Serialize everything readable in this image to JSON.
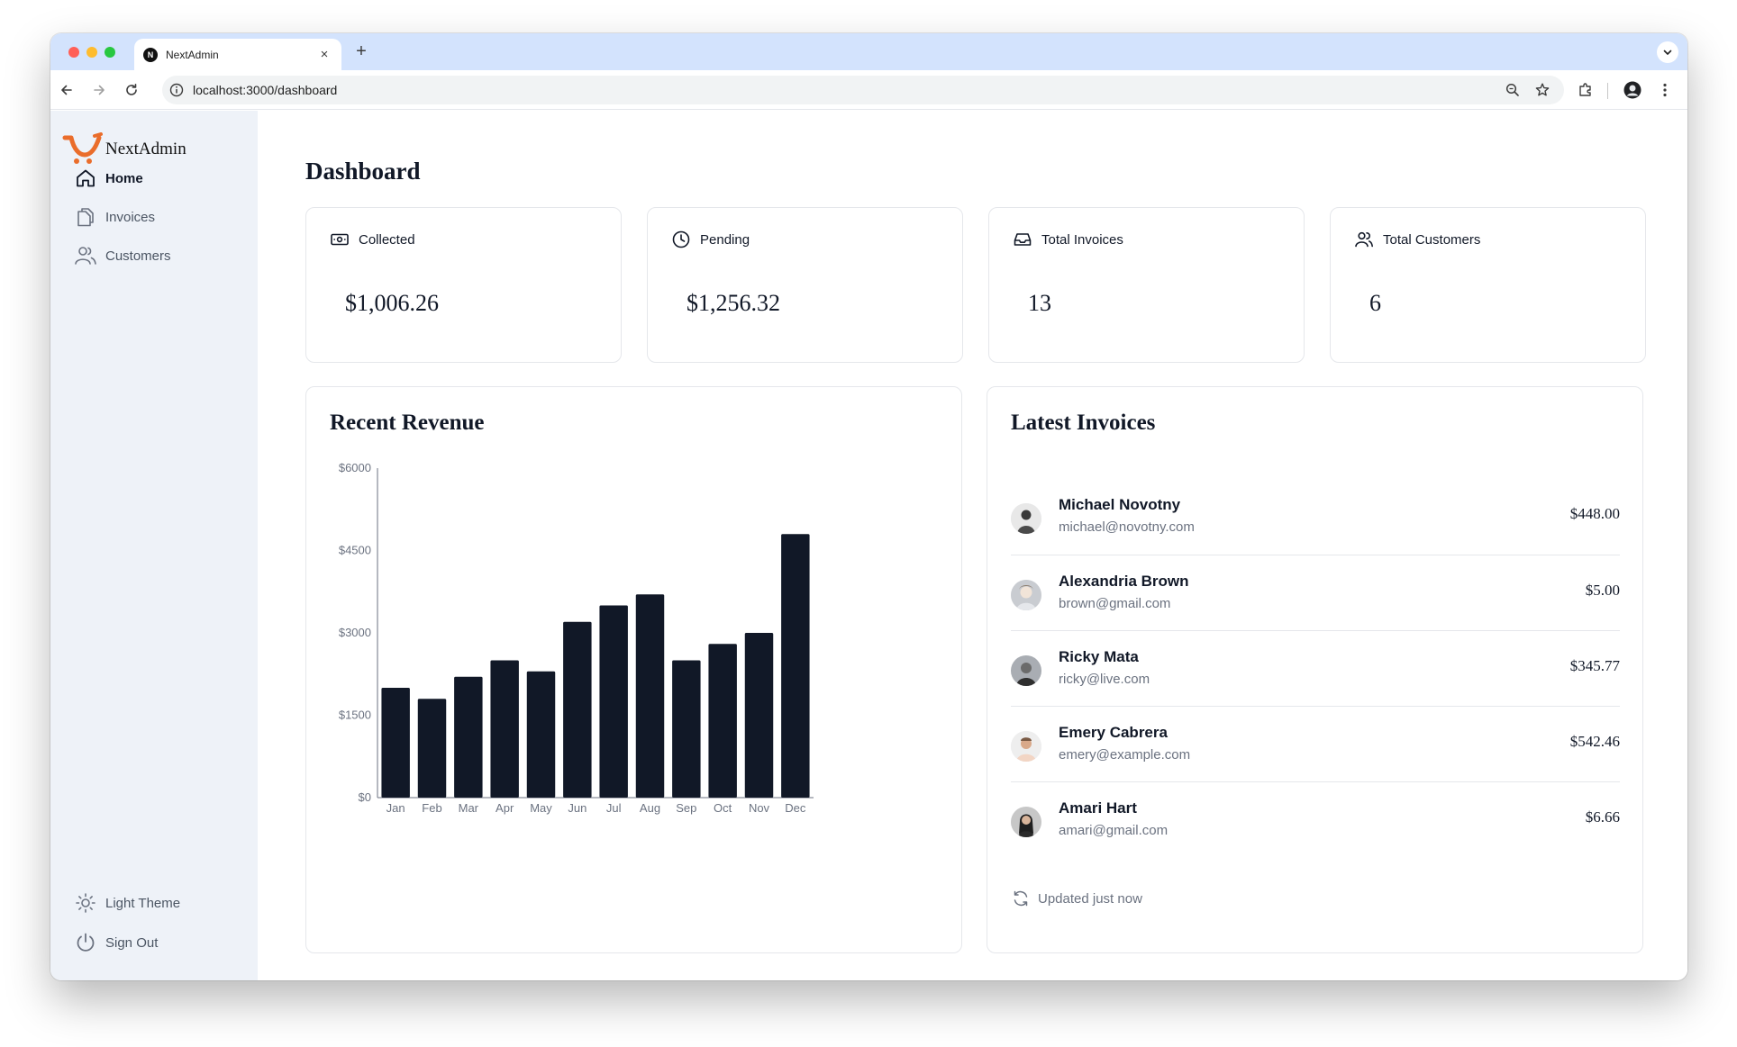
{
  "browser": {
    "tab_title": "NextAdmin",
    "favicon_letter": "N",
    "url": "localhost:3000/dashboard"
  },
  "sidebar": {
    "logo_text": "NextAdmin",
    "items": [
      {
        "label": "Home",
        "icon": "home-icon",
        "active": true
      },
      {
        "label": "Invoices",
        "icon": "documents-icon",
        "active": false
      },
      {
        "label": "Customers",
        "icon": "users-icon",
        "active": false
      }
    ],
    "theme_label": "Light Theme",
    "signout_label": "Sign Out"
  },
  "main": {
    "title": "Dashboard",
    "cards": [
      {
        "label": "Collected",
        "value": "$1,006.26",
        "icon": "banknotes-icon"
      },
      {
        "label": "Pending",
        "value": "$1,256.32",
        "icon": "clock-icon"
      },
      {
        "label": "Total Invoices",
        "value": "13",
        "icon": "inbox-icon"
      },
      {
        "label": "Total Customers",
        "value": "6",
        "icon": "user-group-icon"
      }
    ],
    "revenue": {
      "title": "Recent Revenue"
    },
    "latest_invoices": {
      "title": "Latest Invoices",
      "items": [
        {
          "name": "Michael Novotny",
          "email": "michael@novotny.com",
          "amount": "$448.00"
        },
        {
          "name": "Alexandria Brown",
          "email": "brown@gmail.com",
          "amount": "$5.00"
        },
        {
          "name": "Ricky Mata",
          "email": "ricky@live.com",
          "amount": "$345.77"
        },
        {
          "name": "Emery Cabrera",
          "email": "emery@example.com",
          "amount": "$542.46"
        },
        {
          "name": "Amari Hart",
          "email": "amari@gmail.com",
          "amount": "$6.66"
        }
      ],
      "updated_label": "Updated just now"
    }
  },
  "chart_data": {
    "type": "bar",
    "categories": [
      "Jan",
      "Feb",
      "Mar",
      "Apr",
      "May",
      "Jun",
      "Jul",
      "Aug",
      "Sep",
      "Oct",
      "Nov",
      "Dec"
    ],
    "values": [
      2000,
      1800,
      2200,
      2500,
      2300,
      3200,
      3500,
      3700,
      2500,
      2800,
      3000,
      4800
    ],
    "ylim": [
      0,
      6000
    ],
    "yticks": [
      0,
      1500,
      3000,
      4500,
      6000
    ],
    "ytick_labels": [
      "$0",
      "$1500",
      "$3000",
      "$4500",
      "$6000"
    ],
    "bar_color": "#111827",
    "grid": false
  }
}
